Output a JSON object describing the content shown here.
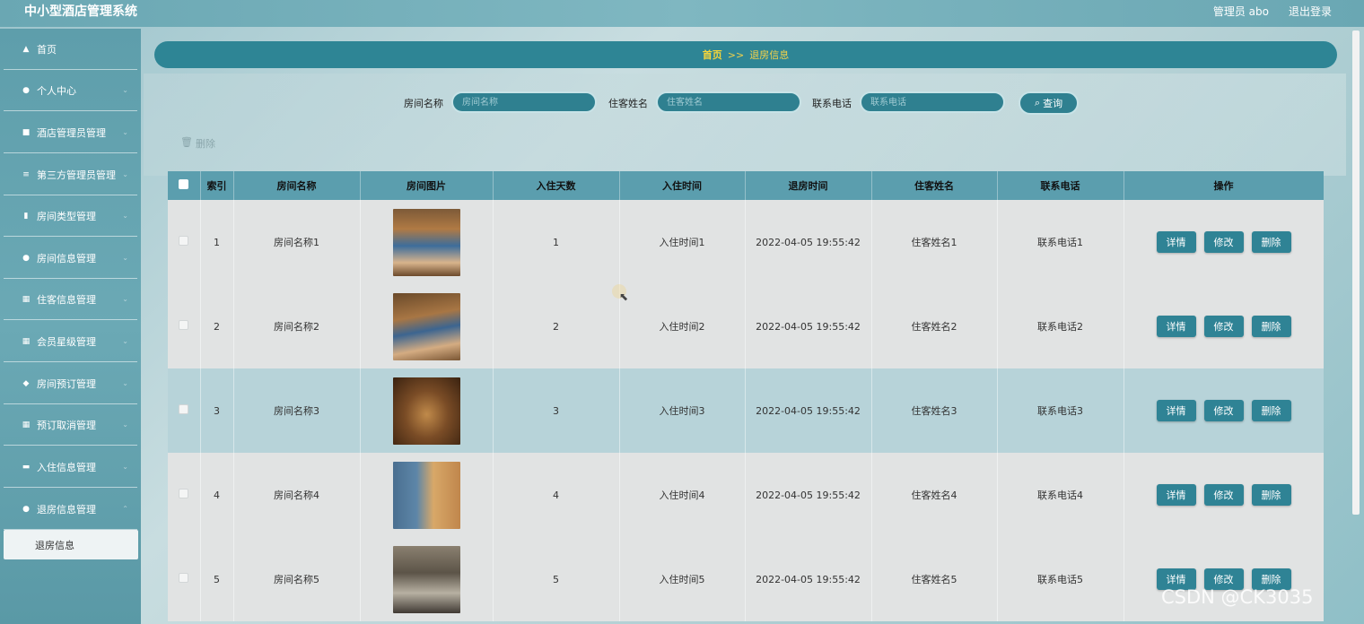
{
  "app": {
    "title": "中小型酒店管理系统"
  },
  "user": {
    "label": "管理员 abo",
    "logout": "退出登录"
  },
  "sidebar": {
    "items": [
      {
        "label": "首页",
        "icon": "home-icon"
      },
      {
        "label": "个人中心",
        "icon": "user-icon"
      },
      {
        "label": "酒店管理员管理",
        "icon": "doc-icon"
      },
      {
        "label": "第三方管理员管理",
        "icon": "list-icon"
      },
      {
        "label": "房间类型管理",
        "icon": "bar-chart-icon"
      },
      {
        "label": "房间信息管理",
        "icon": "user-icon"
      },
      {
        "label": "住客信息管理",
        "icon": "grid-icon"
      },
      {
        "label": "会员星级管理",
        "icon": "grid-icon"
      },
      {
        "label": "房间预订管理",
        "icon": "location-icon"
      },
      {
        "label": "预订取消管理",
        "icon": "grid-icon"
      },
      {
        "label": "入住信息管理",
        "icon": "chat-icon"
      },
      {
        "label": "退房信息管理",
        "icon": "user-icon"
      }
    ],
    "active_sub": "退房信息"
  },
  "breadcrumb": {
    "home": "首页",
    "sep": ">>",
    "current": "退房信息"
  },
  "search": {
    "room_label": "房间名称",
    "room_placeholder": "房间名称",
    "guest_label": "住客姓名",
    "guest_placeholder": "住客姓名",
    "phone_label": "联系电话",
    "phone_placeholder": "联系电话",
    "button": "查询"
  },
  "toolbar": {
    "delete": "删除"
  },
  "table": {
    "headers": [
      "索引",
      "房间名称",
      "房间图片",
      "入住天数",
      "入住时间",
      "退房时间",
      "住客姓名",
      "联系电话",
      "操作"
    ],
    "rows": [
      {
        "index": "1",
        "room": "房间名称1",
        "days": "1",
        "checkin": "入住时间1",
        "checkout": "2022-04-05 19:55:42",
        "guest": "住客姓名1",
        "phone": "联系电话1"
      },
      {
        "index": "2",
        "room": "房间名称2",
        "days": "2",
        "checkin": "入住时间2",
        "checkout": "2022-04-05 19:55:42",
        "guest": "住客姓名2",
        "phone": "联系电话2"
      },
      {
        "index": "3",
        "room": "房间名称3",
        "days": "3",
        "checkin": "入住时间3",
        "checkout": "2022-04-05 19:55:42",
        "guest": "住客姓名3",
        "phone": "联系电话3"
      },
      {
        "index": "4",
        "room": "房间名称4",
        "days": "4",
        "checkin": "入住时间4",
        "checkout": "2022-04-05 19:55:42",
        "guest": "住客姓名4",
        "phone": "联系电话4"
      },
      {
        "index": "5",
        "room": "房间名称5",
        "days": "5",
        "checkin": "入住时间5",
        "checkout": "2022-04-05 19:55:42",
        "guest": "住客姓名5",
        "phone": "联系电话5"
      }
    ],
    "actions": {
      "detail": "详情",
      "edit": "修改",
      "delete": "删除"
    }
  },
  "watermark": "CSDN @CK3035"
}
